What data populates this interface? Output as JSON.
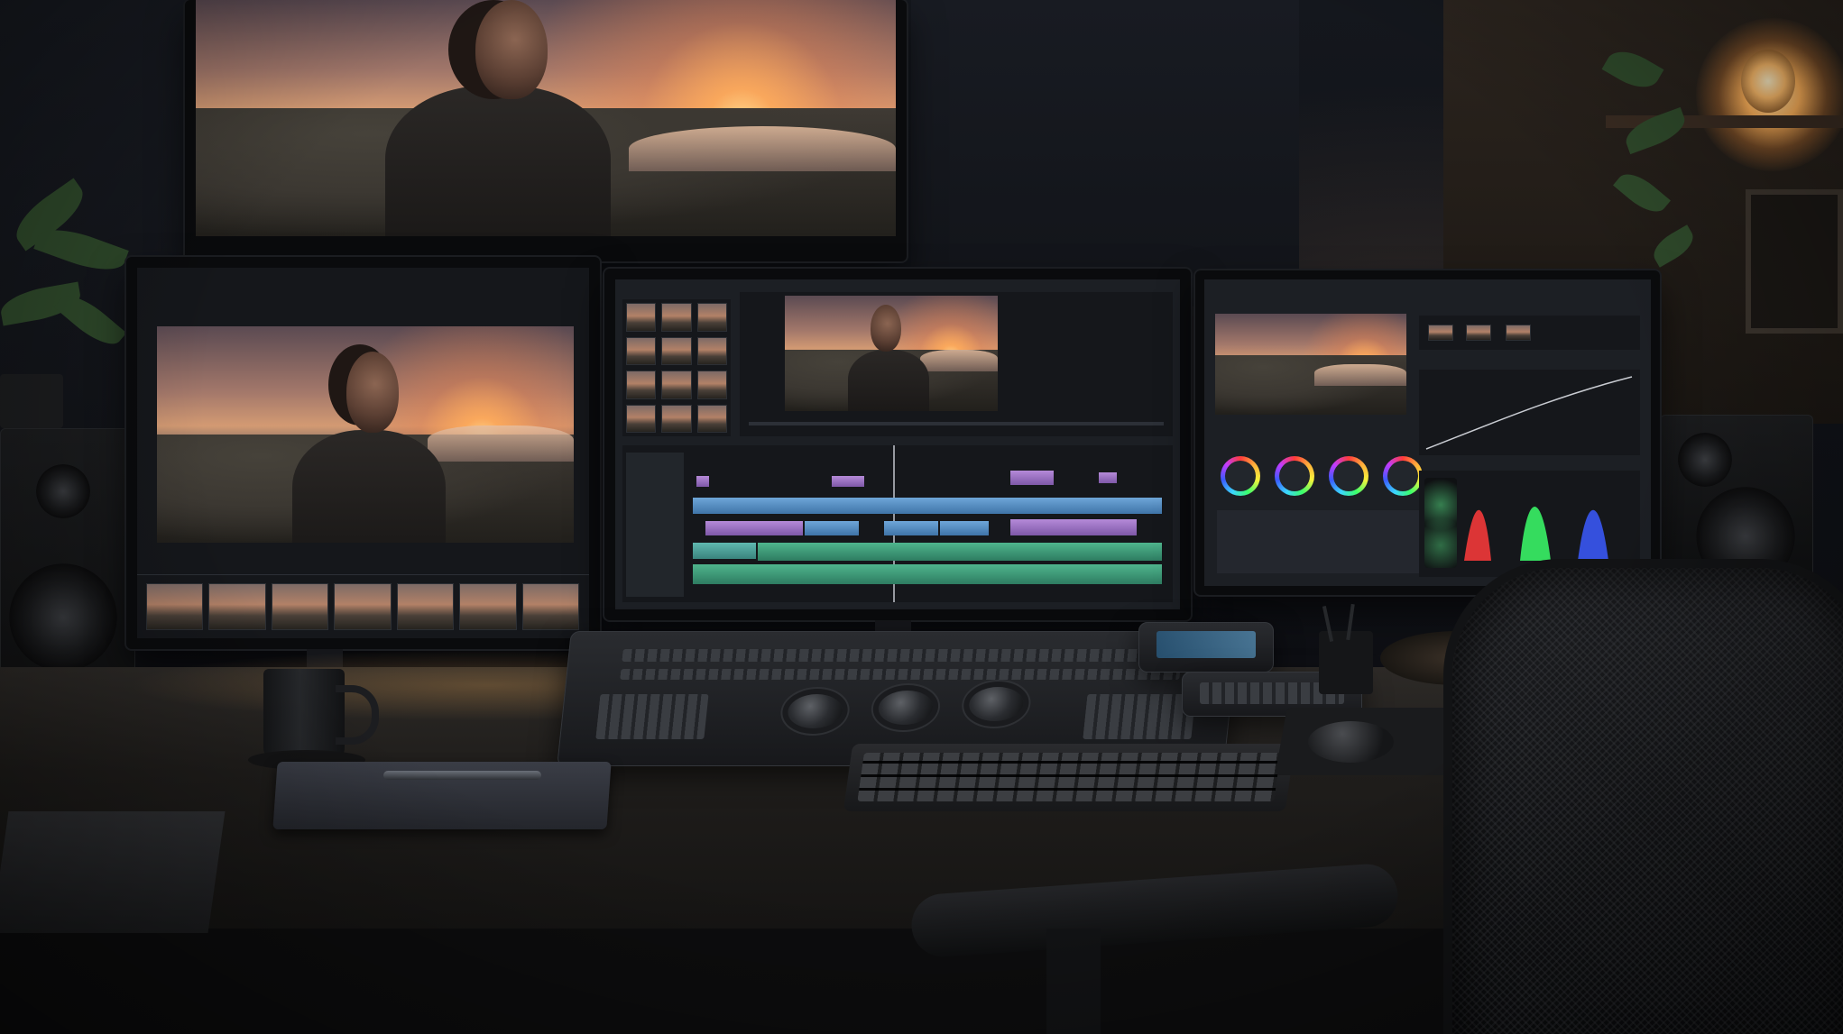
{
  "scene": {
    "description_free": true,
    "colors": {
      "wall": "#14171d",
      "desk": "#2d2a27",
      "warm_light": "#ffb25a",
      "ui_panel": "#1c1f24",
      "scope_red": "#ff3b3b",
      "scope_green": "#3bff6a",
      "scope_blue": "#3b5bff"
    },
    "icons": [
      "speaker-icon",
      "trackball-icon",
      "mug-icon",
      "notebook-icon",
      "mouse-icon",
      "lamp-icon"
    ]
  }
}
